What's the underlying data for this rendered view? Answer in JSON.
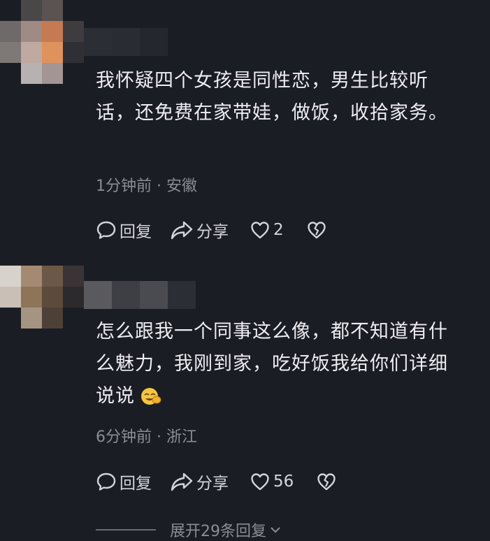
{
  "comments": [
    {
      "text": "我怀疑四个女孩是同性恋，男生比较听话，还免费在家带娃，做饭，收拾家务。",
      "time": "1分钟前",
      "sep": " · ",
      "location": "安徽",
      "reply_label": "回复",
      "share_label": "分享",
      "likes": "2"
    },
    {
      "text": "怎么跟我一个同事这么像，都不知道有什么魅力，我刚到家，吃好饭我给你们详细说说",
      "emoji_icon": "laughing-cover-face-emoji",
      "time": "6分钟前",
      "sep": " · ",
      "location": "浙江",
      "reply_label": "回复",
      "share_label": "分享",
      "likes": "56"
    }
  ],
  "expand": {
    "label": "展开29条回复"
  },
  "colors": {
    "background": "#1b1d24",
    "text": "#ededf2",
    "meta": "#8b8d96",
    "emoji": "#f5c542"
  }
}
